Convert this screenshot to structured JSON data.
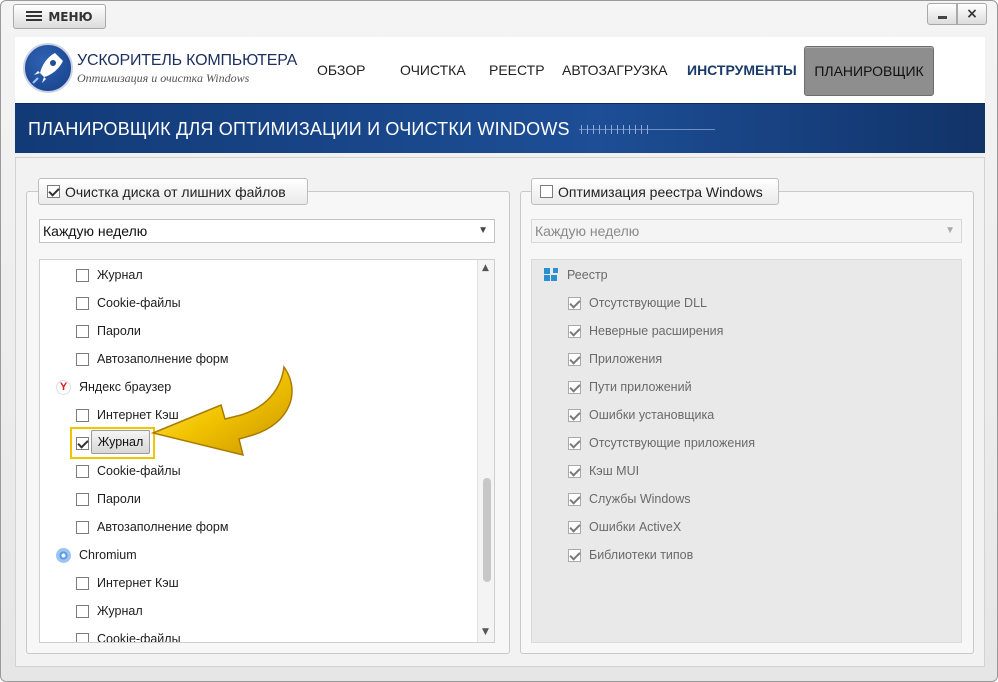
{
  "titlebar": {
    "menu_label": "МЕНЮ",
    "minimize_icon": "minimize-icon",
    "close_icon": "close-icon",
    "close_glyph": "×"
  },
  "header": {
    "app_title": "УСКОРИТЕЛЬ КОМПЬЮТЕРА",
    "app_subtitle": "Оптимизация и очистка Windows",
    "nav": [
      {
        "label": "ОБЗОР"
      },
      {
        "label": "ОЧИСТКА"
      },
      {
        "label": "РЕЕСТР"
      },
      {
        "label": "АВТОЗАГРУЗКА"
      },
      {
        "label": "ИНСТРУМЕНТЫ",
        "active": true
      },
      {
        "label": "ПЛАНИРОВЩИК",
        "selected": true
      }
    ]
  },
  "banner": {
    "title": "ПЛАНИРОВЩИК ДЛЯ ОПТИМИЗАЦИИ И ОЧИСТКИ WINDOWS"
  },
  "left_panel": {
    "legend": "Очистка диска от лишних файлов",
    "legend_checked": true,
    "frequency": "Каждую неделю",
    "items": [
      {
        "label": "Журнал",
        "checked": false,
        "level": 2
      },
      {
        "label": "Cookie-файлы",
        "checked": false,
        "level": 2
      },
      {
        "label": "Пароли",
        "checked": false,
        "level": 2
      },
      {
        "label": "Автозаполнение форм",
        "checked": false,
        "level": 2
      },
      {
        "label": "Яндекс браузер",
        "icon": "yandex-browser-icon",
        "level": 1
      },
      {
        "label": "Интернет Кэш",
        "checked": false,
        "level": 2
      },
      {
        "label": "Журнал",
        "checked": true,
        "level": 2,
        "highlighted": true
      },
      {
        "label": "Cookie-файлы",
        "checked": false,
        "level": 2
      },
      {
        "label": "Пароли",
        "checked": false,
        "level": 2
      },
      {
        "label": "Автозаполнение форм",
        "checked": false,
        "level": 2
      },
      {
        "label": "Chromium",
        "icon": "chromium-icon",
        "level": 1
      },
      {
        "label": "Интернет Кэш",
        "checked": false,
        "level": 2
      },
      {
        "label": "Журнал",
        "checked": false,
        "level": 2
      },
      {
        "label": "Cookie-файлы",
        "checked": false,
        "level": 2
      }
    ]
  },
  "right_panel": {
    "legend": "Оптимизация реестра Windows",
    "legend_checked": false,
    "frequency": "Каждую неделю",
    "group_label": "Реестр",
    "group_icon": "registry-icon",
    "items": [
      {
        "label": "Отсутствующие DLL",
        "checked": true
      },
      {
        "label": "Неверные расширения",
        "checked": true
      },
      {
        "label": "Приложения",
        "checked": true
      },
      {
        "label": "Пути приложений",
        "checked": true
      },
      {
        "label": "Ошибки установщика",
        "checked": true
      },
      {
        "label": "Отсутствующие приложения",
        "checked": true
      },
      {
        "label": "Кэш MUI",
        "checked": true
      },
      {
        "label": "Службы Windows",
        "checked": true
      },
      {
        "label": "Ошибки ActiveX",
        "checked": true
      },
      {
        "label": "Библиотеки типов",
        "checked": true
      }
    ]
  },
  "colors": {
    "banner": "#1d4e96",
    "highlight": "#f0c400",
    "arrow": "#f2c300"
  }
}
